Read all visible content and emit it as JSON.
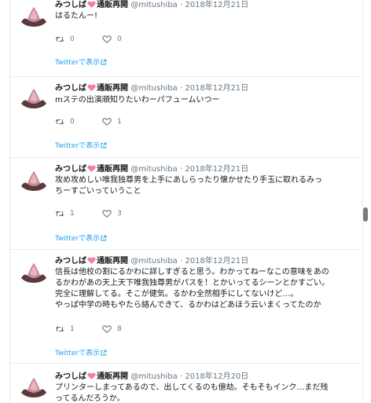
{
  "timeline": {
    "tweets": [
      {
        "display_name": "みつしば",
        "shop_status": "通販再開",
        "handle": "@mitushiba",
        "separator": "·",
        "date": "2018年12月21日",
        "lines": [
          "はるたんー!"
        ],
        "retweets": "0",
        "likes": "0",
        "view_link": "Twitterで表示"
      },
      {
        "display_name": "みつしば",
        "shop_status": "通販再開",
        "handle": "@mitushiba",
        "separator": "·",
        "date": "2018年12月21日",
        "lines": [
          "mステの出演順知りたいわーパフュームいつー"
        ],
        "retweets": "0",
        "likes": "1",
        "view_link": "Twitterで表示"
      },
      {
        "display_name": "みつしば",
        "shop_status": "通販再開",
        "handle": "@mitushiba",
        "separator": "·",
        "date": "2018年12月21日",
        "lines": [
          "攻め攻めしい唯我独尊男を上手にあしらったり懐かせたり手玉に取れるみっ",
          "ちーすごいっていうこと"
        ],
        "retweets": "1",
        "likes": "3",
        "view_link": "Twitterで表示"
      },
      {
        "display_name": "みつしば",
        "shop_status": "通販再開",
        "handle": "@mitushiba",
        "separator": "·",
        "date": "2018年12月21日",
        "lines": [
          "信長は他校の割にるかわに詳しすぎると思う。わかってねーなこの意味をあの",
          "るかわがあの天上天下唯我独尊男がパスを！とかいってるシーンとかすごい。",
          "完全に理解してる。そこが健気。るかわ全然相手にしてないけど…。",
          "やっぱ中学の時もやたら絡んできて、るかわはどあほう云いまくってたのか"
        ],
        "retweets": "1",
        "likes": "8",
        "view_link": "Twitterで表示"
      },
      {
        "display_name": "みつしば",
        "shop_status": "通販再開",
        "handle": "@mitushiba",
        "separator": "·",
        "date": "2018年12月20日",
        "lines": [
          "プリンターしまってあるので、出してくるのも億劫。そもそもインク…まだ残",
          "ってるんだろうか。"
        ],
        "retweets": "",
        "likes": "",
        "view_link": ""
      }
    ]
  }
}
